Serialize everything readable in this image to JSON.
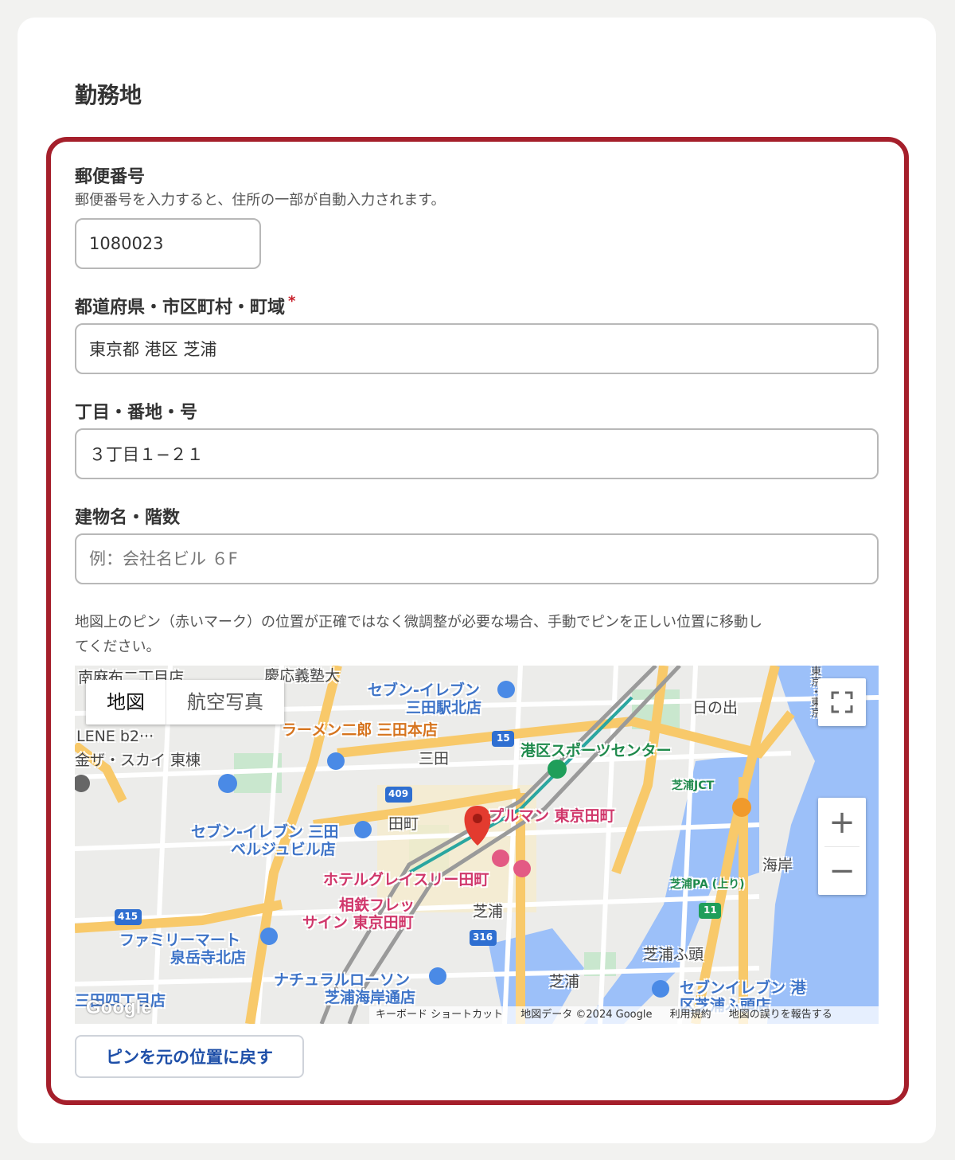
{
  "section": {
    "title": "勤務地"
  },
  "postal": {
    "label": "郵便番号",
    "help": "郵便番号を入力すると、住所の一部が自動入力されます。",
    "value": "1080023"
  },
  "prefecture": {
    "label": "都道府県・市区町村・町域",
    "required_mark": "*",
    "value": "東京都 港区 芝浦"
  },
  "block": {
    "label": "丁目・番地・号",
    "value": "３丁目１−２１"
  },
  "building": {
    "label": "建物名・階数",
    "placeholder": "例：会社名ビル ６F",
    "value": ""
  },
  "map_help": {
    "line1": "地図上のピン（赤いマーク）の位置が正確ではなく微調整が必要な場合、手動でピンを正しい位置に移動し",
    "line2": "てください。"
  },
  "map": {
    "type_map": "地図",
    "type_satellite": "航空写真",
    "zoom_in": "+",
    "zoom_out": "−",
    "labels": {
      "seven_mita_kitaten": "セブン-イレブン",
      "seven_mita_kitaten2": "三田駅北店",
      "ramen": "ラーメン二郎 三田本店",
      "mita": "三田",
      "minato_sports": "港区スポーツセンター",
      "hinode": "日の出",
      "shibaura_jct": "芝浦JCT",
      "seven_bell1": "セブン-イレブン 三田",
      "seven_bell2": "ベルジュビル店",
      "tamachi": "田町",
      "pullman": "プルマン 東京田町",
      "gracery": "ホテルグレイスリー田町",
      "sotetsu1": "相鉄フレッ",
      "sotetsu2": "サイン 東京田町",
      "shibaura": "芝浦",
      "kaigan": "海岸",
      "shibaura_pa": "芝浦PA (上り)",
      "family1": "ファミリーマート",
      "family2": "泉岳寺北店",
      "lawson1": "ナチュラルローソン",
      "lawson2": "芝浦海岸通店",
      "shibaura_futo": "芝浦ふ頭",
      "shibaura2": "芝浦",
      "seven_port1": "セブンイレブン 港",
      "seven_port2": "区芝浦ふ頭店",
      "mita4": "三田四丁目店",
      "sky": "金ザ・スカイ 東棟",
      "lene": "LENE b2···",
      "minami": "南麻布二丁目店",
      "keio": "慶応義塾大",
      "r409": "409",
      "r15": "15",
      "r415": "415",
      "r316": "316",
      "r11": "11",
      "tokyo1": "東京・東京"
    },
    "footer": {
      "shortcuts": "キーボード ショートカット",
      "data": "地図データ ©2024 Google",
      "terms": "利用規約",
      "report": "地図の誤りを報告する"
    },
    "logo": "Google"
  },
  "reset_button": "ピンを元の位置に戻す"
}
